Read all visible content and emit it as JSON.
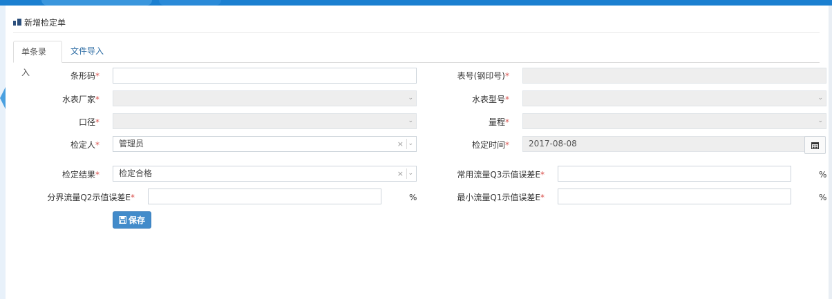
{
  "page": {
    "title": "新增检定单"
  },
  "tabs": [
    {
      "label": "单条录入",
      "active": true
    },
    {
      "label": "文件导入",
      "active": false
    }
  ],
  "form": {
    "barcode": {
      "label": "条形码",
      "value": ""
    },
    "meter_no": {
      "label": "表号(钢印号)",
      "value": ""
    },
    "manufacturer": {
      "label": "水表厂家",
      "value": ""
    },
    "model": {
      "label": "水表型号",
      "value": ""
    },
    "caliber": {
      "label": "口径",
      "value": ""
    },
    "range": {
      "label": "量程",
      "value": ""
    },
    "inspector": {
      "label": "检定人",
      "value": "管理员",
      "clear": "×"
    },
    "inspect_time": {
      "label": "检定时间",
      "value": "2017-08-08"
    },
    "result": {
      "label": "检定结果",
      "value": "检定合格",
      "clear": "×"
    },
    "q3_error": {
      "label": "常用流量Q3示值误差E",
      "value": "",
      "unit": "%"
    },
    "q2_error": {
      "label": "分界流量Q2示值误差E",
      "value": "",
      "unit": "%"
    },
    "q1_error": {
      "label": "最小流量Q1示值误差E",
      "value": "",
      "unit": "%"
    },
    "required_mark": "*",
    "chevron": "⌄"
  },
  "actions": {
    "save_label": "保存"
  },
  "colors": {
    "primary": "#428bca",
    "topbar": "#1b7fd0",
    "required": "#d9534f",
    "tab_link": "#2f6ea5"
  },
  "icons": {
    "title": "panel-title-icon",
    "calendar": "calendar-icon",
    "save": "floppy-disk-icon"
  }
}
